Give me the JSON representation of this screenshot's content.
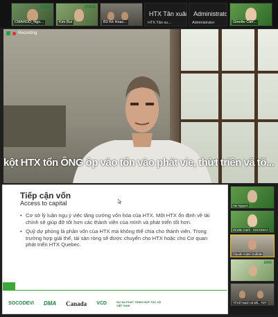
{
  "top_strip": {
    "tiles": [
      {
        "name": "CMARDD_Ngo..."
      },
      {
        "name": "Kim Bui"
      },
      {
        "name": "B3 Kế Hoạc..."
      },
      {
        "name": "HTX Tân xu..."
      },
      {
        "name": "Administrator"
      },
      {
        "name": "Ginette Carr..."
      }
    ],
    "text_tiles": [
      {
        "label": "HTX Tân xuân...",
        "sublabel": "HTX Tân xu..."
      },
      {
        "label": "Administrator",
        "sublabel": "Administrator"
      }
    ],
    "dma_label": "DMA"
  },
  "main_video": {
    "recording_label": "Recording",
    "caption": "kột HTX tổn ÔNG ôp vào tổn vào phát vie, thừt triên vã tỗ..."
  },
  "slide": {
    "title": "Tiếp cận vốn",
    "subtitle": "Access to capital",
    "bullets": [
      "Cơ sở lý luận ngụ ý việc tăng cường vốn hóa của HTX. Một HTX ổn định về tài chính sẽ giúp đỡ tốt hơn các thành viên của mình và phát triển tốt hơn.",
      "Quỹ dự phòng là phần vốn của HTX mà không thể chia cho thành viên. Trong trường hợp giải thể, tài sản ròng sẽ được chuyển cho HTX hoặc cho Cơ quan phát triển HTX Quebec."
    ],
    "footer": {
      "socodevi": "SOCODEVI",
      "dma": "DMA",
      "canada": "Canada",
      "vcd": "VCD",
      "project": "DỰ ÁN PHÁT TRIỂN HỢP TÁC XÃ VIỆT NAM"
    }
  },
  "gallery": {
    "tiles": [
      {
        "name": "Hai Nguyen"
      },
      {
        "name": "Ginette Carré - SOCODEVI"
      },
      {
        "name": "Claude-André Guillotte"
      },
      {
        "name": ""
      },
      {
        "name": "Tổ Kế hoạch và Đầ... TDT"
      }
    ]
  },
  "colors": {
    "accent_green": "#3fa63a",
    "recording_red": "#e03131",
    "active_speaker": "#f0c419"
  }
}
